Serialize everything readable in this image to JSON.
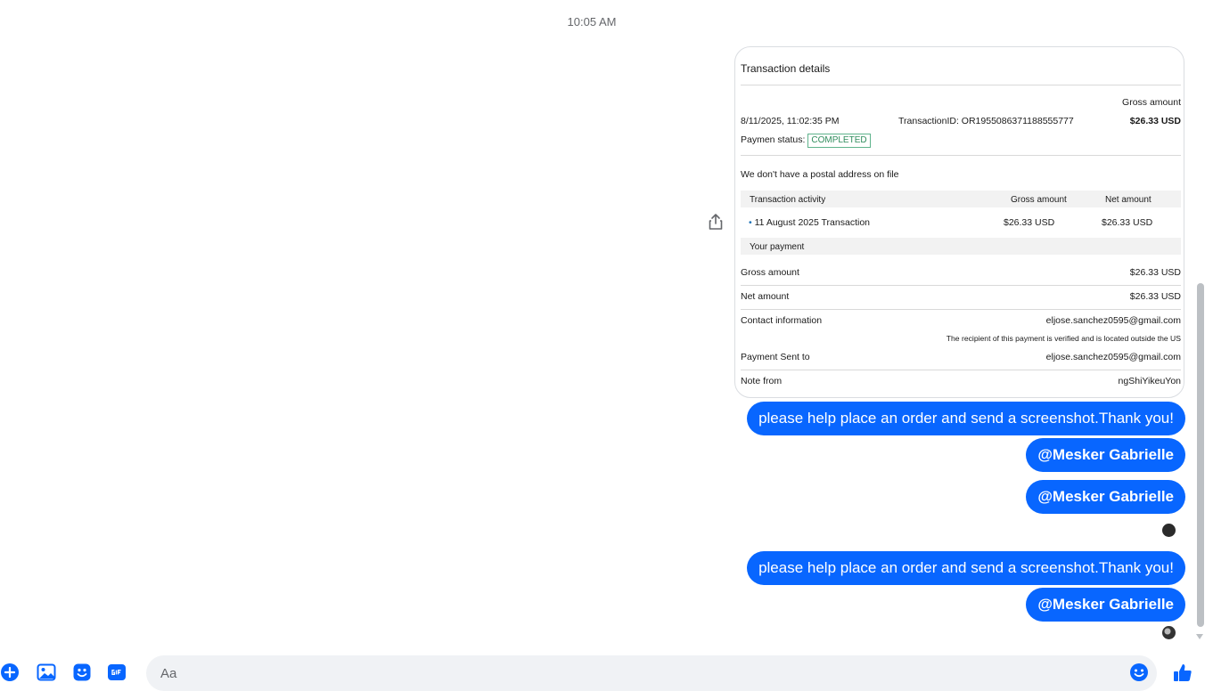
{
  "chat": {
    "timestamp": "10:05 AM"
  },
  "receipt": {
    "title": "Transaction details",
    "gross_amount_label": "Gross amount",
    "date": "8/11/2025, 11:02:35 PM",
    "transaction_id": "TransactionID: OR1955086371188555777",
    "gross_total": "$26.33 USD",
    "status_label": "Paymen status:",
    "status_value": "COMPLETED",
    "address_note": "We don't have a postal address on file",
    "activity_headers": [
      "Transaction activity",
      "Gross amount",
      "Net amount"
    ],
    "activity_row": {
      "description": "11 August 2025 Transaction",
      "gross": "$26.33 USD",
      "net": "$26.33 USD"
    },
    "your_payment_label": "Your payment",
    "rows": [
      {
        "label": "Gross amount",
        "value": "$26.33 USD"
      },
      {
        "label": "Net amount",
        "value": "$26.33 USD"
      },
      {
        "label": "Contact information",
        "value": "eljose.sanchez0595@gmail.com"
      }
    ],
    "verified_note": "The recipient of this payment is verified and is located outside the US",
    "sent_to_label": "Payment Sent to",
    "sent_to_value": "eljose.sanchez0595@gmail.com",
    "note_label": "Note from",
    "note_value": "ngShiYikeuYon"
  },
  "messages": [
    "please help place an order and send a screenshot.Thank you!",
    "@Mesker Gabrielle",
    "@Mesker Gabrielle",
    "please help place an order and send a screenshot.Thank you!",
    "@Mesker Gabrielle"
  ],
  "composer": {
    "placeholder": "Aa"
  },
  "colors": {
    "bubble": "#0866ff",
    "icon": "#0866ff",
    "status_green": "#2f8c5c"
  }
}
